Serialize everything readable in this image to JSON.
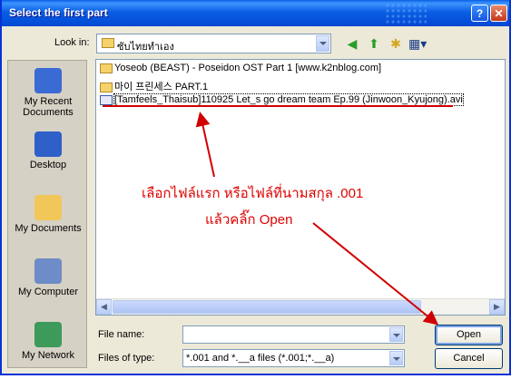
{
  "window": {
    "title": "Select the first part",
    "help_glyph": "?",
    "close_glyph": "✕"
  },
  "lookin": {
    "label": "Look in:",
    "value": "ซับไทยทำเอง"
  },
  "toolbar": {
    "back_glyph": "◀",
    "up_glyph": "⬆",
    "newfolder_glyph": "✱",
    "views_glyph": "▦▾"
  },
  "places": [
    {
      "label": "My Recent\nDocuments",
      "icon": "recent-docs-icon",
      "color": "#3a6ad4"
    },
    {
      "label": "Desktop",
      "icon": "desktop-icon",
      "color": "#2f5fc8"
    },
    {
      "label": "My Documents",
      "icon": "my-documents-icon",
      "color": "#f1c75a"
    },
    {
      "label": "My Computer",
      "icon": "my-computer-icon",
      "color": "#6d8cc8"
    },
    {
      "label": "My Network",
      "icon": "my-network-icon",
      "color": "#3c9a5a"
    }
  ],
  "files": [
    {
      "name": "Yoseob (BEAST) - Poseidon OST Part 1 [www.k2nblog.com]",
      "type": "folder"
    },
    {
      "name": "마이 프린세스 PART.1",
      "type": "folder"
    },
    {
      "name": "[Tamfeels_Thaisub]110925 Let_s go dream team Ep.99 (Jinwoon_Kyujong).avi",
      "type": "video"
    }
  ],
  "filename": {
    "label": "File name:",
    "value": ""
  },
  "filetype": {
    "label": "Files of type:",
    "value": "*.001 and *.__a files (*.001;*.__a)"
  },
  "buttons": {
    "open": "Open",
    "cancel": "Cancel"
  },
  "annotation": {
    "line1": "เลือกไฟล์แรก  หรือไฟล์ที่นามสกุล .001",
    "line2": "แล้วคลิ๊ก  Open",
    "color": "#e00000"
  },
  "scroll": {
    "left_glyph": "◀",
    "right_glyph": "▶"
  }
}
